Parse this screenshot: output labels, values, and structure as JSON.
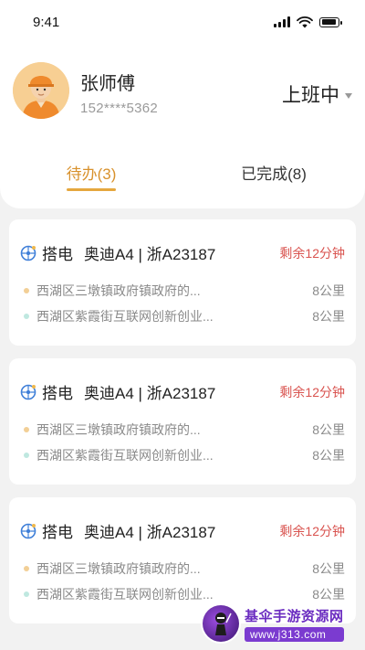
{
  "status_bar": {
    "time": "9:41"
  },
  "user": {
    "name": "张师傅",
    "phone": "152****5362",
    "work_status": "上班中"
  },
  "tabs": [
    {
      "label": "待办(3)",
      "active": true
    },
    {
      "label": "已完成(8)",
      "active": false
    }
  ],
  "orders": [
    {
      "type": "搭电",
      "car": "奥迪A4 | 浙A23187",
      "remaining": "剩余12分钟",
      "from": {
        "address": "西湖区三墩镇政府镇政府的...",
        "distance": "8公里"
      },
      "to": {
        "address": "西湖区紫霞街互联网创新创业...",
        "distance": "8公里"
      }
    },
    {
      "type": "搭电",
      "car": "奥迪A4 | 浙A23187",
      "remaining": "剩余12分钟",
      "from": {
        "address": "西湖区三墩镇政府镇政府的...",
        "distance": "8公里"
      },
      "to": {
        "address": "西湖区紫霞街互联网创新创业...",
        "distance": "8公里"
      }
    },
    {
      "type": "搭电",
      "car": "奥迪A4 | 浙A23187",
      "remaining": "剩余12分钟",
      "from": {
        "address": "西湖区三墩镇政府镇政府的...",
        "distance": "8公里"
      },
      "to": {
        "address": "西湖区紫霞街互联网创新创业...",
        "distance": "8公里"
      }
    }
  ],
  "watermark": {
    "title": "基伞手游资源网",
    "url": "www.j313.com"
  },
  "colors": {
    "accent": "#d8912c",
    "alert": "#d9534f",
    "muted": "#8a8a8a"
  }
}
